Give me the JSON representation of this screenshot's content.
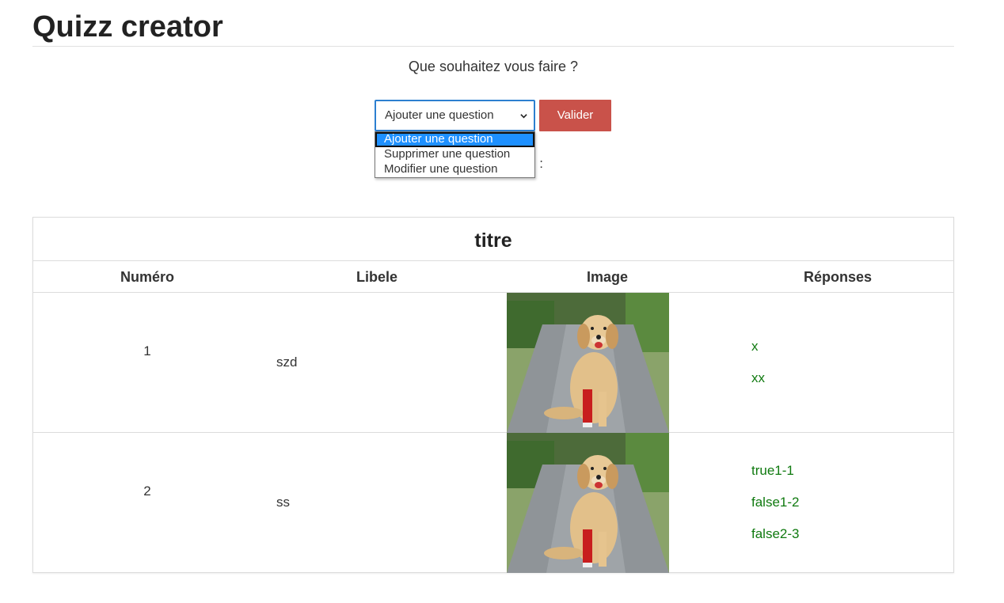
{
  "header": {
    "title": "Quizz creator"
  },
  "action": {
    "prompt": "Que souhaitez vous faire ?",
    "selected": "Ajouter une question",
    "options": [
      "Ajouter une question",
      "Supprimer une question",
      "Modifier une question"
    ],
    "submit_label": "Valider",
    "partial_label": "z :"
  },
  "quiz": {
    "title": "titre",
    "columns": [
      "Numéro",
      "Libele",
      "Image",
      "Réponses"
    ],
    "rows": [
      {
        "numero": "1",
        "libele": "szd",
        "image": "dog-photo",
        "reponses": [
          "x",
          "xx"
        ]
      },
      {
        "numero": "2",
        "libele": "ss",
        "image": "dog-photo",
        "reponses": [
          "true1-1",
          "false1-2",
          "false2-3"
        ]
      }
    ]
  },
  "colors": {
    "accent": "#c9524a",
    "answer": "#107a10",
    "highlight": "#1e90ff"
  }
}
